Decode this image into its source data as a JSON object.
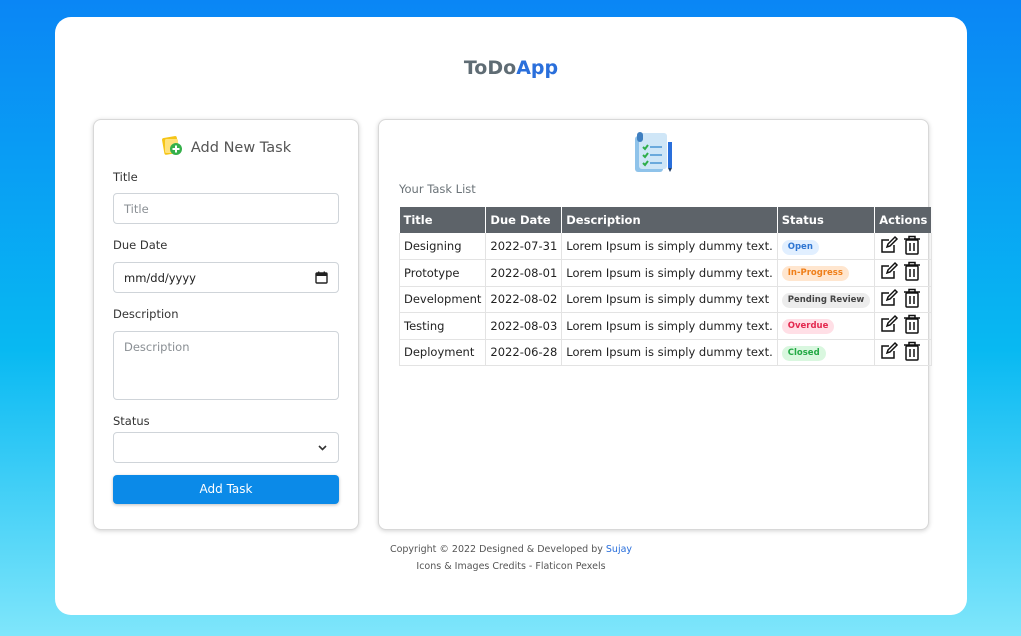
{
  "app": {
    "title_part1": "ToDo",
    "title_part2": "App"
  },
  "form": {
    "heading": "Add New Task",
    "title_label": "Title",
    "title_placeholder": "Title",
    "due_label": "Due Date",
    "due_value": "mm/dd/yyyy",
    "desc_label": "Description",
    "desc_placeholder": "Description",
    "status_label": "Status",
    "status_value": "",
    "add_button": "Add Task"
  },
  "list": {
    "caption": "Your Task List",
    "headers": [
      "Title",
      "Due Date",
      "Description",
      "Status",
      "Actions"
    ],
    "rows": [
      {
        "title": "Designing",
        "due": "2022-07-31",
        "desc": "Lorem Ipsum is simply dummy text.",
        "status": "Open"
      },
      {
        "title": "Prototype",
        "due": "2022-08-01",
        "desc": "Lorem Ipsum is simply dummy text.",
        "status": "In-Progress"
      },
      {
        "title": "Development",
        "due": "2022-08-02",
        "desc": "Lorem Ipsum is simply dummy text",
        "status": "Pending Review"
      },
      {
        "title": "Testing",
        "due": "2022-08-03",
        "desc": "Lorem Ipsum is simply dummy text.",
        "status": "Overdue"
      },
      {
        "title": "Deployment",
        "due": "2022-06-28",
        "desc": "Lorem Ipsum is simply dummy text.",
        "status": "Closed"
      }
    ]
  },
  "footer": {
    "line1_prefix": "Copyright © 2022 Designed & Developed by ",
    "author": "Sujay",
    "line2": "Icons & Images Credits - Flaticon Pexels"
  },
  "colors": {
    "accent": "#2a6fdb",
    "button": "#0b8ae8",
    "table_header": "#5d6369"
  }
}
